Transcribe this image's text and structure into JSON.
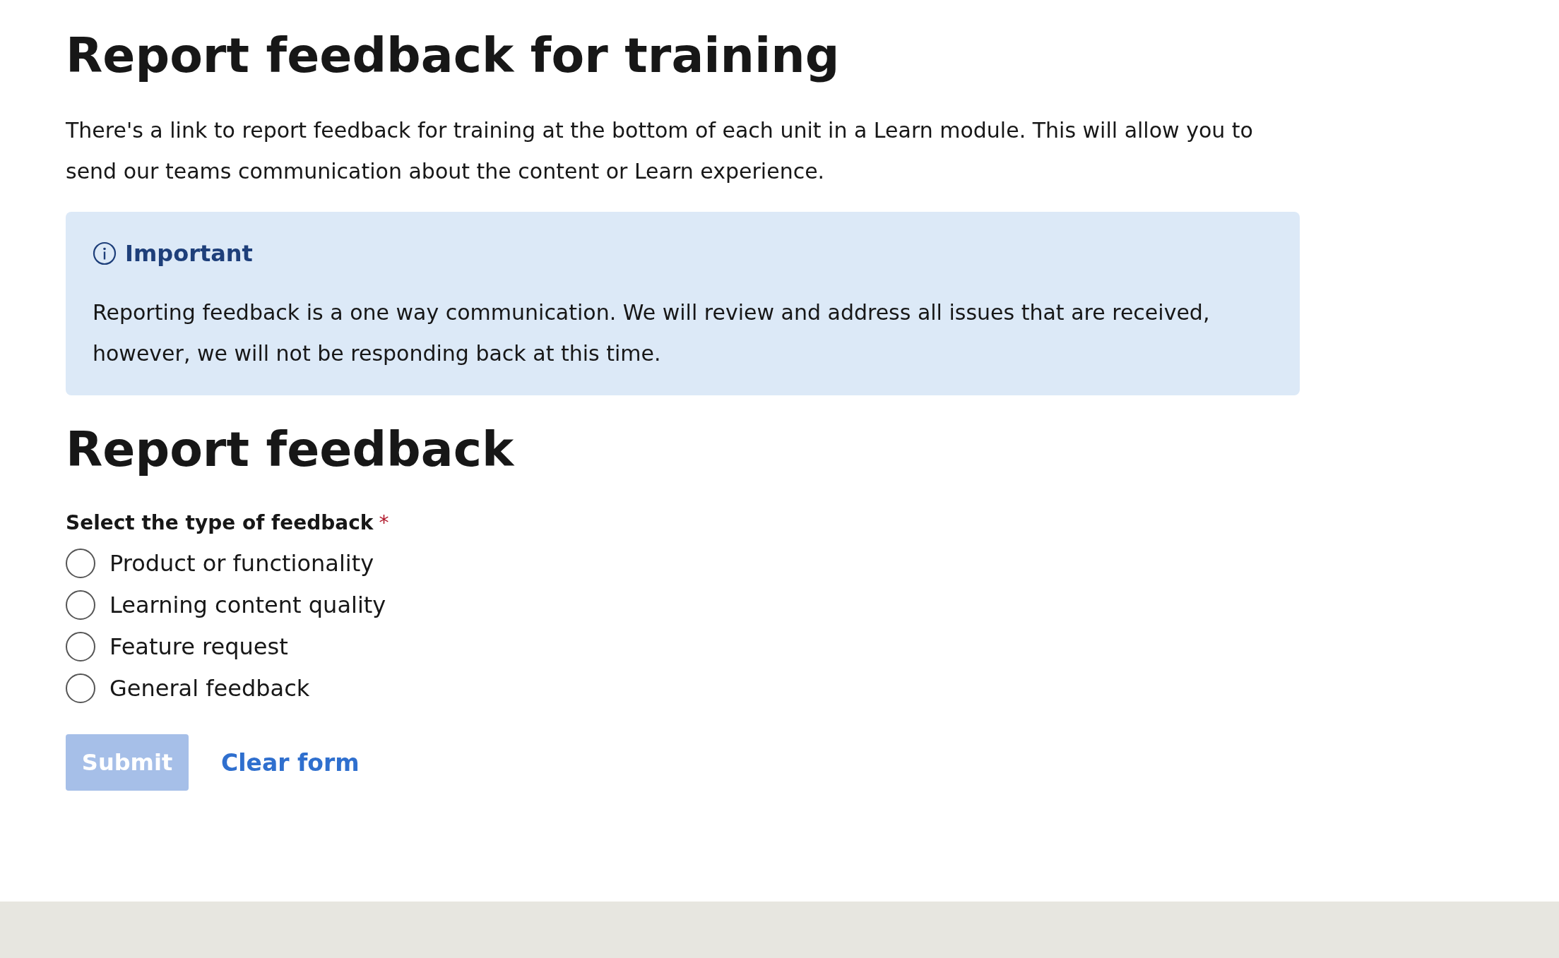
{
  "title": "Report feedback for training",
  "intro": "There's a link to report feedback for training at the bottom of each unit in a Learn module. This will allow you to send our teams communication about the content or Learn experience.",
  "callout": {
    "heading": "Important",
    "text": "Reporting feedback is a one way communication. We will review and address all issues that are received, however, we will not be responding back at this time."
  },
  "form": {
    "heading": "Report feedback",
    "question": "Select the type of feedback",
    "required_mark": "*",
    "options": [
      {
        "label": "Product or functionality",
        "selected": false
      },
      {
        "label": "Learning content quality",
        "selected": false
      },
      {
        "label": "Feature request",
        "selected": false
      },
      {
        "label": "General feedback",
        "selected": false
      }
    ],
    "submit": {
      "label": "Submit",
      "disabled": true
    },
    "clear": {
      "label": "Clear form"
    }
  }
}
